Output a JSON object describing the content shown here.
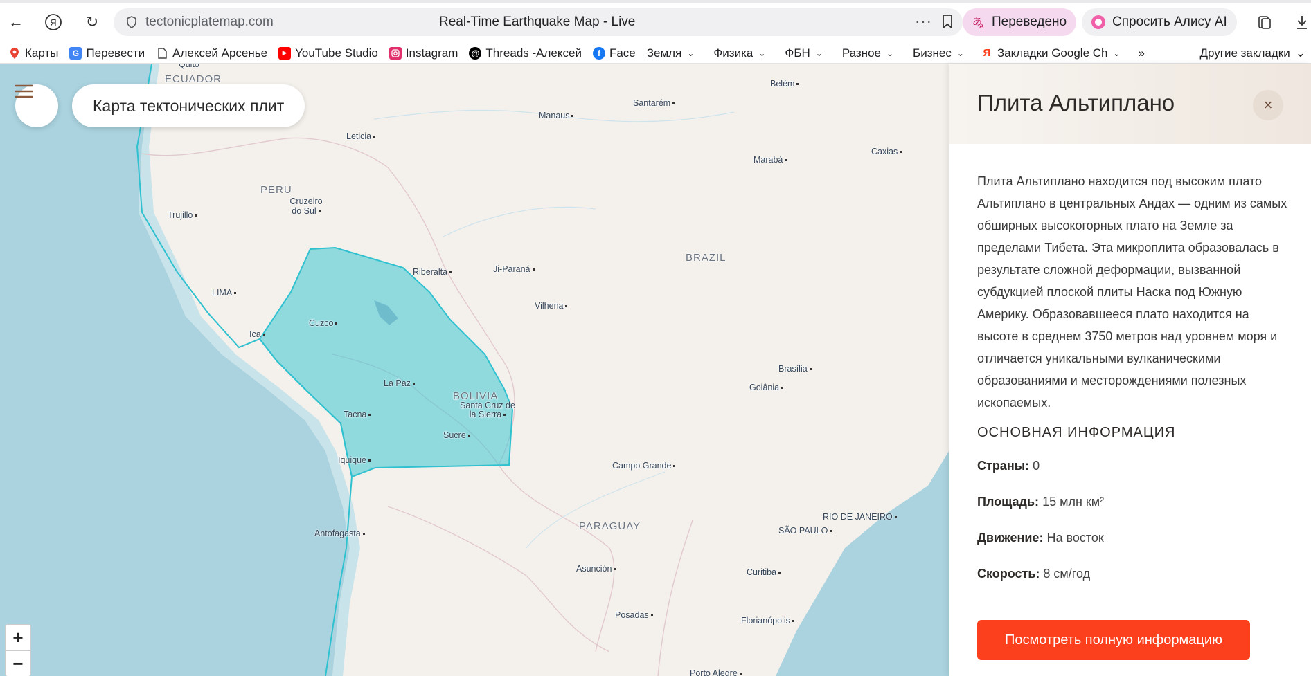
{
  "browser": {
    "url": "tectonicplatemap.com",
    "title": "Real-Time Earthquake Map - Live",
    "translate_label": "Переведено",
    "alice_label": "Спросить Алису AI"
  },
  "bookmarks": [
    {
      "label": "Карты",
      "icon": "maps-pin-icon",
      "color": "#34a853"
    },
    {
      "label": "Перевести",
      "icon": "translate-icon",
      "color": "#4285f4"
    },
    {
      "label": "Алексей Арсенье",
      "icon": "page-icon",
      "color": "#555555"
    },
    {
      "label": "YouTube Studio",
      "icon": "youtube-icon",
      "color": "#ff0000"
    },
    {
      "label": "Instagram",
      "icon": "instagram-icon",
      "color": "#e1306c"
    },
    {
      "label": "Threads -Алексей",
      "icon": "threads-icon",
      "color": "#000000"
    },
    {
      "label": "Face",
      "icon": "facebook-icon",
      "color": "#1877f2"
    },
    {
      "label": "Земля",
      "folder": true
    },
    {
      "label": "Физика",
      "folder": true
    },
    {
      "label": "ФБН",
      "folder": true
    },
    {
      "label": "Разное",
      "folder": true
    },
    {
      "label": "Бизнес",
      "folder": true
    },
    {
      "label": "Закладки Google Ch",
      "icon": "yandex-icon",
      "color": "#fc3f1d",
      "folder": true
    }
  ],
  "bookmarks_more": "»",
  "bookmarks_other": "Другие закладки",
  "map": {
    "title": "Карта тектонических плит",
    "zoom_in": "+",
    "zoom_out": "−",
    "highlight_color": "#3ec6d4",
    "labels": [
      {
        "text": "ECUADOR",
        "type": "country"
      },
      {
        "text": "Quito",
        "type": "city"
      },
      {
        "text": "Leticia",
        "type": "city"
      },
      {
        "text": "Manaus",
        "type": "city"
      },
      {
        "text": "Santarém",
        "type": "city"
      },
      {
        "text": "Belém",
        "type": "city"
      },
      {
        "text": "Marabá",
        "type": "city"
      },
      {
        "text": "Caxias",
        "type": "city"
      },
      {
        "text": "PERU",
        "type": "country"
      },
      {
        "text": "Cruzeiro do Sul",
        "type": "city"
      },
      {
        "text": "Trujillo",
        "type": "city"
      },
      {
        "text": "BRAZIL",
        "type": "country"
      },
      {
        "text": "Riberalta",
        "type": "city"
      },
      {
        "text": "Ji-Paraná",
        "type": "city"
      },
      {
        "text": "LIMA",
        "type": "city"
      },
      {
        "text": "Vilhena",
        "type": "city"
      },
      {
        "text": "Cuzco",
        "type": "city"
      },
      {
        "text": "Ica",
        "type": "city"
      },
      {
        "text": "La Paz",
        "type": "city"
      },
      {
        "text": "BOLIVIA",
        "type": "country"
      },
      {
        "text": "Santa Cruz de la Sierra",
        "type": "city"
      },
      {
        "text": "Brasília",
        "type": "city"
      },
      {
        "text": "Goiânia",
        "type": "city"
      },
      {
        "text": "Tacna",
        "type": "city"
      },
      {
        "text": "Sucre",
        "type": "city"
      },
      {
        "text": "Iquique",
        "type": "city"
      },
      {
        "text": "Campo Grande",
        "type": "city"
      },
      {
        "text": "PARAGUAY",
        "type": "country"
      },
      {
        "text": "RIO DE JANEIRO",
        "type": "city"
      },
      {
        "text": "SÃO PAULO",
        "type": "city"
      },
      {
        "text": "Antofagasta",
        "type": "city"
      },
      {
        "text": "Asunción",
        "type": "city"
      },
      {
        "text": "Curitiba",
        "type": "city"
      },
      {
        "text": "Posadas",
        "type": "city"
      },
      {
        "text": "Florianópolis",
        "type": "city"
      },
      {
        "text": "Porto Alegre",
        "type": "city"
      }
    ]
  },
  "panel": {
    "title": "Плита Альтиплано",
    "close": "×",
    "description": "Плита Альтиплано находится под высоким плато Альтиплано в центральных Андах — одним из самых обширных высокогорных плато на Земле за пределами Тибета. Эта микроплита образовалась в результате сложной деформации, вызванной субдукцией плоской плиты Наска под Южную Америку. Образовавшееся плато находится на высоте в среднем 3750 метров над уровнем моря и отличается уникальными вулканическими образованиями и месторождениями полезных ископаемых.",
    "section_heading": "ОСНОВНАЯ ИНФОРМАЦИЯ",
    "info": [
      {
        "label": "Страны:",
        "value": "0"
      },
      {
        "label": "Площадь:",
        "value": "15 млн км²"
      },
      {
        "label": "Движение:",
        "value": "На восток"
      },
      {
        "label": "Скорость:",
        "value": "8 см/год"
      }
    ],
    "cta_label": "Посмотреть полную информацию",
    "accent_color": "#fc3f1d"
  }
}
